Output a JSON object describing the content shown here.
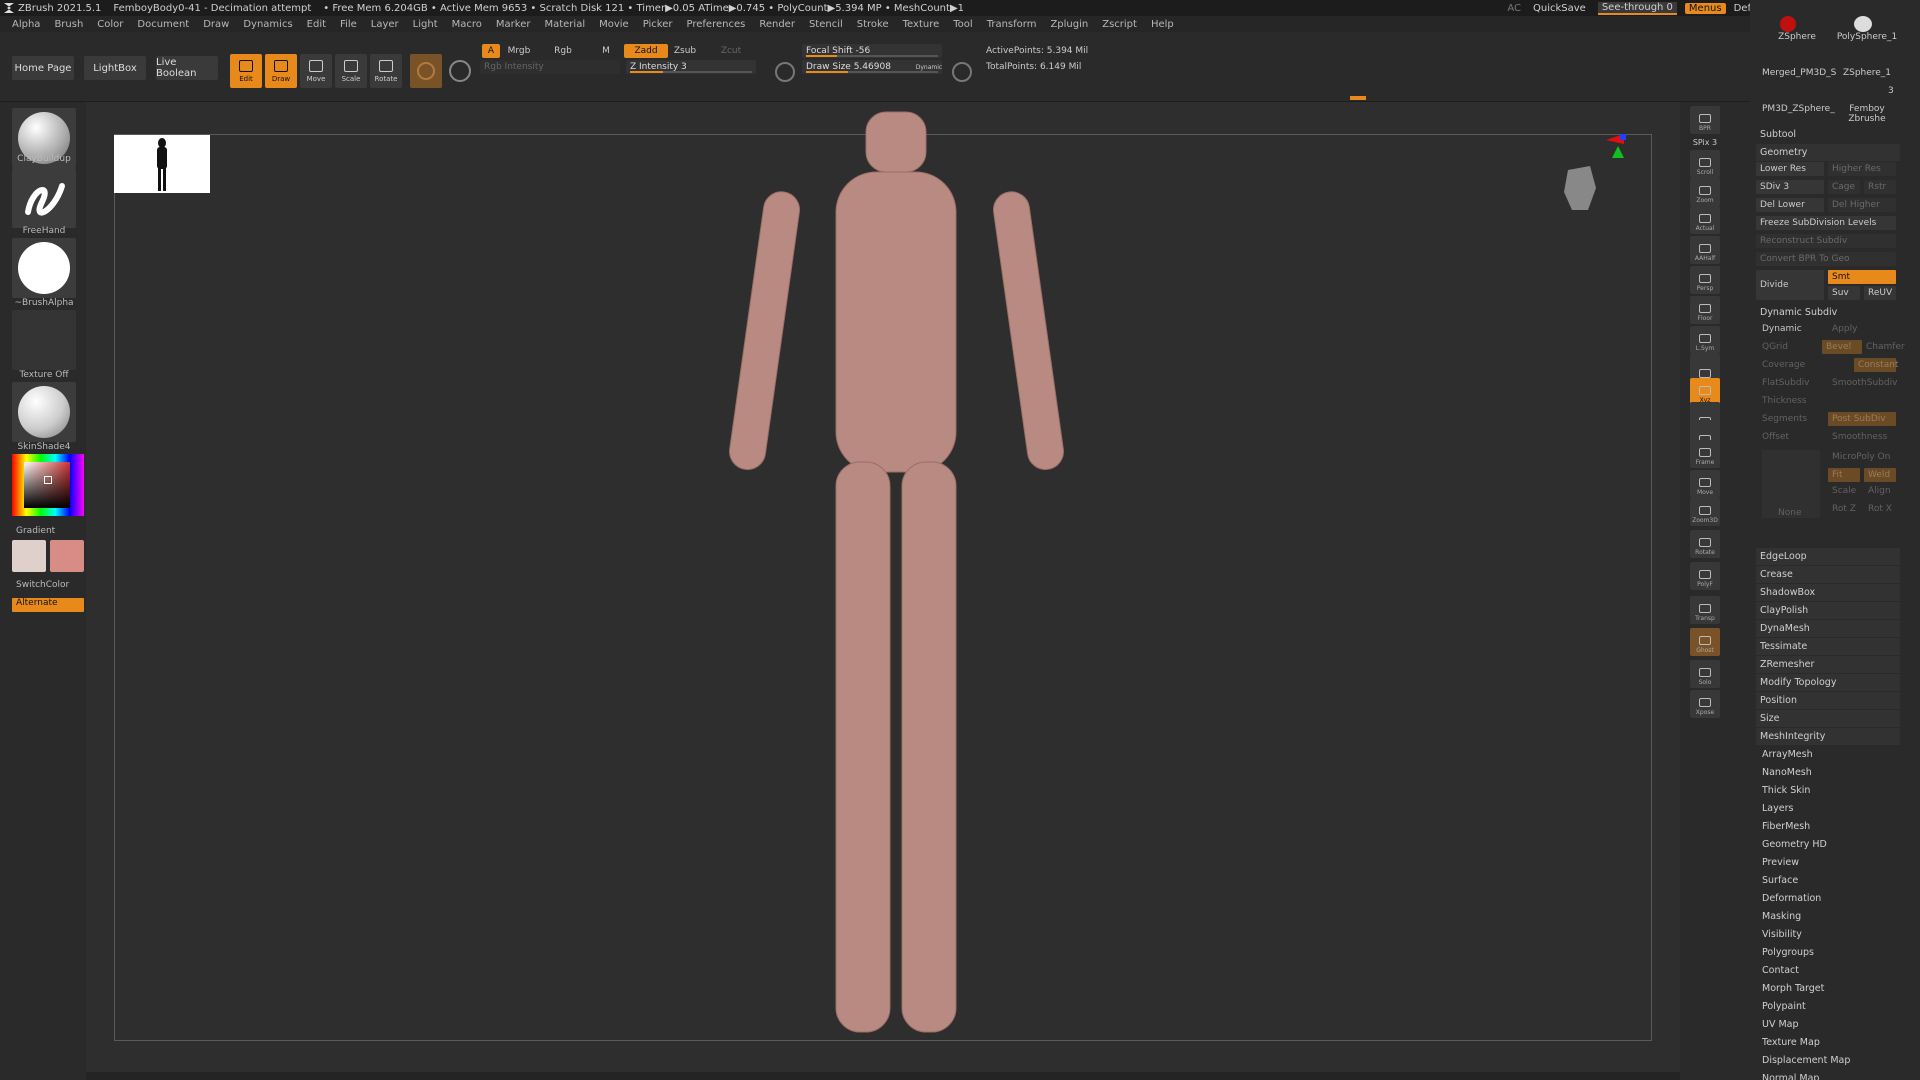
{
  "title_bar": {
    "app": "ZBrush 2021.5.1",
    "document": "FemboyBody0-41 - Decimation attempt",
    "stats": "• Free Mem 6.204GB • Active Mem 9653 • Scratch Disk 121 • Timer▶0.05 ATime▶0.745 • PolyCount▶5.394 MP • MeshCount▶1",
    "ac": "AC",
    "quicksave": "QuickSave",
    "seethrough": "See-through  0",
    "menus": "Menus",
    "script": "DefaultZScript"
  },
  "menu": [
    "Alpha",
    "Brush",
    "Color",
    "Document",
    "Draw",
    "Dynamics",
    "Edit",
    "File",
    "Layer",
    "Light",
    "Macro",
    "Marker",
    "Material",
    "Movie",
    "Picker",
    "Preferences",
    "Render",
    "Stencil",
    "Stroke",
    "Texture",
    "Tool",
    "Transform",
    "Zplugin",
    "Zscript",
    "Help"
  ],
  "toolbar": {
    "home": "Home Page",
    "lightbox": "LightBox",
    "live_boolean": "Live Boolean",
    "edit": "Edit",
    "draw": "Draw",
    "move": "Move",
    "scale": "Scale",
    "rotate": "Rotate",
    "a": "A",
    "mrgb": "Mrgb",
    "rgb": "Rgb",
    "m": "M",
    "zadd": "Zadd",
    "zsub": "Zsub",
    "zcut": "Zcut",
    "rgb_intensity": "Rgb Intensity",
    "z_intensity": "Z Intensity 3",
    "focal_shift": "Focal Shift -56",
    "draw_size": "Draw Size 5.46908",
    "dynamic": "Dynamic",
    "active_points": "ActivePoints: 5.394 Mil",
    "total_points": "TotalPoints: 6.149 Mil",
    "z_intensity_level": 0.25,
    "focal_shift_level": 0.22,
    "draw_size_level": 0.3
  },
  "left_shelf": {
    "brush": "ClayBuildup",
    "stroke": "FreeHand",
    "alpha": "~BrushAlpha",
    "texture": "Texture Off",
    "material": "SkinShade4",
    "gradient": "Gradient",
    "switch_color": "SwitchColor",
    "alternate": "Alternate"
  },
  "right_shelf": [
    "BPR",
    "SPix 3",
    "Scroll",
    "Zoom",
    "Actual",
    "AAHalf",
    "Persp",
    "Floor",
    "L.Sym",
    "",
    "Xyz",
    "",
    "",
    "Frame",
    "Move",
    "Zoom3D",
    "Rotate",
    "PolyF",
    "Transp",
    "Ghost",
    "Solo",
    "Xpose"
  ],
  "tray": {
    "subtools": [
      "ZSphere",
      "PolySphere_1",
      "Merged_PM3D_S",
      "ZSphere_1",
      "PM3D_ZSphere_",
      "Femboy Zbrushe"
    ],
    "subtool_count": "3",
    "subtool": "Subtool",
    "geometry": "Geometry",
    "lower_res": "Lower Res",
    "higher_res": "Higher Res",
    "sdiv": "SDiv 3",
    "cage": "Cage",
    "rstr": "Rstr",
    "del_lower": "Del Lower",
    "del_higher": "Del Higher",
    "freeze": "Freeze SubDivision Levels",
    "reconstruct": "Reconstruct Subdiv",
    "convert_bpr": "Convert BPR To Geo",
    "divide": "Divide",
    "smt": "Smt",
    "suv": "Suv",
    "reuv": "ReUV",
    "dynamic_subdiv": "Dynamic Subdiv",
    "dynamic": "Dynamic",
    "apply": "Apply",
    "qgrid": "QGrid",
    "bevel": "Bevel",
    "chamfer": "Chamfer",
    "coverage": "Coverage",
    "constant": "Constant",
    "flatsubdiv": "FlatSubdiv",
    "smoothsubdiv": "SmoothSubdiv",
    "thickness": "Thickness",
    "segments": "Segments",
    "postsubdiv": "Post SubDiv",
    "offset": "Offset",
    "smoothness": "Smoothness",
    "micropoly": "MicroPoly On",
    "fit": "Fit",
    "weld": "Weld",
    "scale": "Scale",
    "align": "Align",
    "rotz": "Rot Z",
    "rotx": "Rot X",
    "none": "None",
    "items": [
      "EdgeLoop",
      "Crease",
      "ShadowBox",
      "ClayPolish",
      "DynaMesh",
      "Tessimate",
      "ZRemesher",
      "Modify Topology",
      "Position",
      "Size",
      "MeshIntegrity"
    ],
    "items2": [
      "ArrayMesh",
      "NanoMesh",
      "Thick Skin",
      "Layers",
      "FiberMesh",
      "Geometry HD",
      "Preview",
      "Surface",
      "Deformation",
      "Masking",
      "Visibility",
      "Polygroups",
      "Contact",
      "Morph Target",
      "Polypaint",
      "UV Map",
      "Texture Map",
      "Displacement Map",
      "Normal Map"
    ]
  },
  "colors": {
    "accent": "#e8891c",
    "material": "#c97f76",
    "swatch_main": "#e0d0cc",
    "swatch_secondary": "#d88c86"
  }
}
